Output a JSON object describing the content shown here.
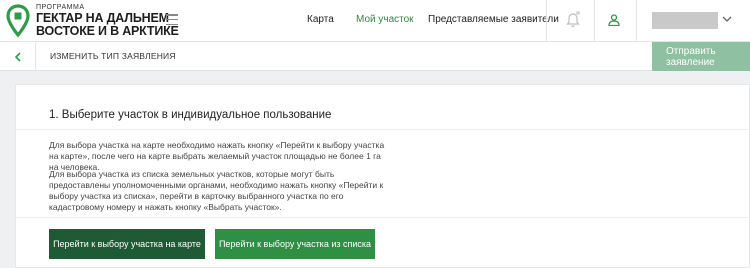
{
  "header": {
    "logo_pre": "ПРОГРАММА",
    "logo_line1": "ГЕКТАР НА ДАЛЬНЕМ",
    "logo_line2": "ВОСТОКЕ И В АРКТИКЕ",
    "nav": {
      "map": "Карта",
      "my_plot": "Мой участок",
      "representatives": "Представляемые заявители"
    }
  },
  "subbar": {
    "title": "ИЗМЕНИТЬ ТИП ЗАЯВЛЕНИЯ",
    "send_label": "Отправить заявление"
  },
  "card": {
    "title": "1. Выберите участок в индивидуальное пользование",
    "paragraph1": "Для выбора участка на карте необходимо нажать кнопку «Перейти к выбору участка на карте», после чего на карте выбрать желаемый участок площадью не более 1 га на человека.",
    "paragraph2": "Для выбора участка из списка земельных участков, которые могут быть предоставлены уполномоченными органами, необходимо нажать кнопку «Перейти к выбору участка из списка», перейти в карточку выбранного участка по его кадастровому номеру и нажать кнопку «Выбрать участок».",
    "btn_map": "Перейти к выбору участка на карте",
    "btn_list": "Перейти к выбору участка из списка"
  },
  "colors": {
    "accent": "#2e8b3f",
    "btn_dark": "#1e5a34",
    "btn_light": "#2f8f45",
    "send_disabled": "#8fc0a1"
  },
  "icons": [
    "map-pin-logo-icon",
    "menu-icon",
    "bell-icon",
    "user-icon",
    "chevron-down-icon",
    "chevron-left-icon"
  ]
}
